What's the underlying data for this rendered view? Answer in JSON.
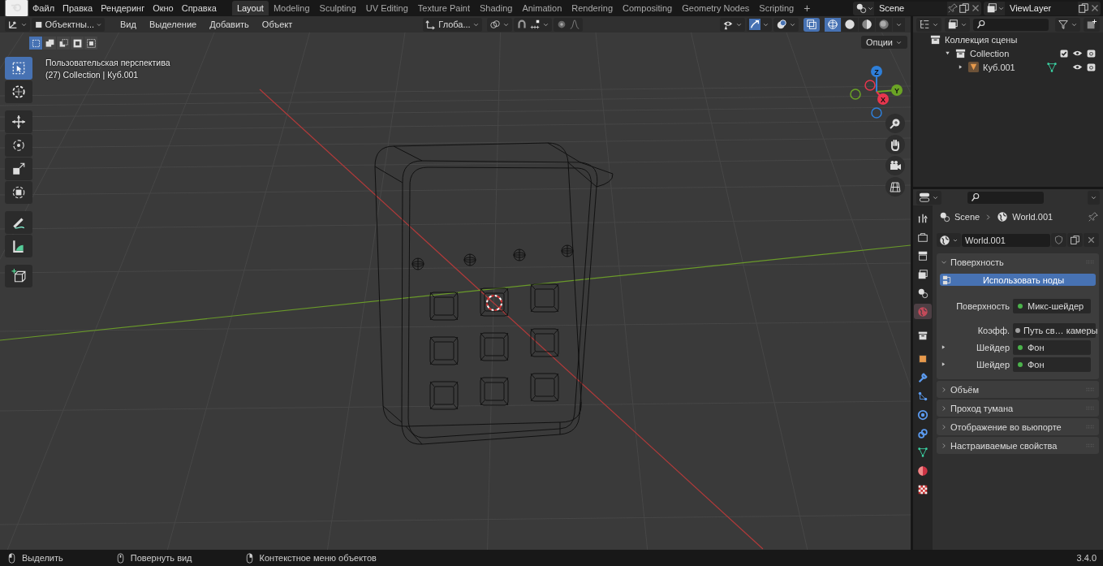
{
  "app_menu": [
    "Файл",
    "Правка",
    "Рендеринг",
    "Окно",
    "Справка"
  ],
  "workspaces": [
    {
      "label": "Layout",
      "selected": true
    },
    {
      "label": "Modeling",
      "selected": false
    },
    {
      "label": "Sculpting",
      "selected": false
    },
    {
      "label": "UV Editing",
      "selected": false
    },
    {
      "label": "Texture Paint",
      "selected": false
    },
    {
      "label": "Shading",
      "selected": false
    },
    {
      "label": "Animation",
      "selected": false
    },
    {
      "label": "Rendering",
      "selected": false
    },
    {
      "label": "Compositing",
      "selected": false
    },
    {
      "label": "Geometry Nodes",
      "selected": false
    },
    {
      "label": "Scripting",
      "selected": false
    }
  ],
  "add_workspace": "+",
  "scene": "Scene",
  "view_layer": "ViewLayer",
  "viewport": {
    "mode": "Объектны...",
    "menus": [
      "Вид",
      "Выделение",
      "Добавить",
      "Объект"
    ],
    "orientation": "Глоба...",
    "options": "Опции",
    "select_modes": [
      {
        "selected": true
      },
      {
        "selected": false
      },
      {
        "selected": false
      },
      {
        "selected": false
      },
      {
        "selected": false
      }
    ],
    "shading": [
      {
        "kind": "wireframe",
        "selected": true
      },
      {
        "kind": "solid",
        "selected": false
      },
      {
        "kind": "material",
        "selected": false
      },
      {
        "kind": "rendered",
        "selected": false
      }
    ],
    "info": [
      "Пользовательская перспектива",
      "(27) Collection | Куб.001"
    ],
    "tools": [
      {
        "kind": "select",
        "selected": true
      },
      {
        "kind": "cursor",
        "selected": false
      },
      {
        "kind": "move",
        "selected": false
      },
      {
        "kind": "rotate",
        "selected": false
      },
      {
        "kind": "scale",
        "selected": false
      },
      {
        "kind": "transform",
        "selected": false
      },
      {
        "kind": "annotate",
        "selected": false
      },
      {
        "kind": "measure",
        "selected": false
      },
      {
        "kind": "addcube",
        "selected": false
      }
    ],
    "axes": [
      {
        "label": "Z",
        "color": "#2e7fd9"
      },
      {
        "label": "Y",
        "color": "#6ba425"
      },
      {
        "label": "X",
        "color": "#e8364e"
      }
    ]
  },
  "outliner": {
    "tree": [
      {
        "label": "Коллекция сцены",
        "kind": "scene-collection",
        "children": [
          {
            "label": "Collection",
            "kind": "collection",
            "expanded": true,
            "checked": true,
            "children": [
              {
                "label": "Куб.001",
                "kind": "mesh",
                "expanded": false
              }
            ]
          }
        ]
      }
    ]
  },
  "properties": {
    "tabs": [
      {
        "kind": "tool",
        "selected": false
      },
      {
        "kind": "render",
        "selected": false
      },
      {
        "kind": "output",
        "selected": false
      },
      {
        "kind": "viewlayer",
        "selected": false
      },
      {
        "kind": "scene",
        "selected": false
      },
      {
        "kind": "world",
        "selected": true
      },
      {
        "kind": "collection",
        "selected": false
      },
      {
        "kind": "object",
        "selected": false
      },
      {
        "kind": "modifier",
        "selected": false
      },
      {
        "kind": "particles",
        "selected": false
      },
      {
        "kind": "physics",
        "selected": false
      },
      {
        "kind": "constraints",
        "selected": false
      },
      {
        "kind": "data",
        "selected": false
      },
      {
        "kind": "material",
        "selected": false
      },
      {
        "kind": "texture",
        "selected": false
      }
    ],
    "breadcrumb": [
      "Scene",
      "World.001"
    ],
    "datablock": "World.001",
    "panels": [
      {
        "title": "Поверхность",
        "expanded": true,
        "button": "Использовать ноды",
        "rows": [
          {
            "label": "Поверхность",
            "value": "Микс-шейдер",
            "color": "#4bb34b",
            "expandable": false
          },
          {
            "label": "Коэфф.",
            "value": "Путь св… камеры",
            "color": "#a0a0a0",
            "expandable": false
          },
          {
            "label": "Шейдер",
            "value": "Фон",
            "color": "#4bb34b",
            "expandable": true
          },
          {
            "label": "Шейдер",
            "value": "Фон",
            "color": "#4bb34b",
            "expandable": true
          }
        ]
      },
      {
        "title": "Объём",
        "expanded": false
      },
      {
        "title": "Проход тумана",
        "expanded": false
      },
      {
        "title": "Отображение во вьюпорте",
        "expanded": false
      },
      {
        "title": "Настраиваемые свойства",
        "expanded": false
      }
    ]
  },
  "status_bar": {
    "hints": [
      {
        "kind": "left",
        "label": "Выделить"
      },
      {
        "kind": "middle",
        "label": "Повернуть вид"
      },
      {
        "kind": "right",
        "label": "Контекстное меню объектов"
      }
    ],
    "version": "3.4.0"
  }
}
